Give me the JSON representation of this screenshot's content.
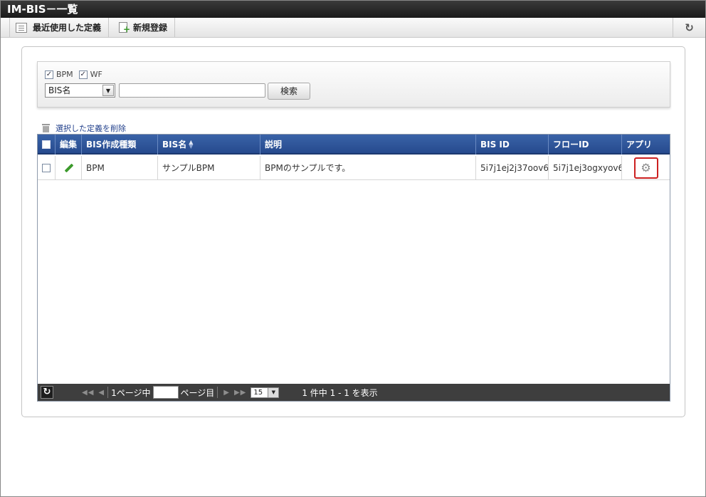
{
  "window": {
    "title": "IM-BIS－一覧"
  },
  "toolbar": {
    "recent_label": "最近使用した定義",
    "new_label": "新規登録",
    "refresh_icon": "refresh-icon"
  },
  "search": {
    "filters": [
      {
        "label": "BPM",
        "checked": true
      },
      {
        "label": "WF",
        "checked": true
      }
    ],
    "field_select_value": "BIS名",
    "keyword_value": "",
    "button_label": "検索"
  },
  "actions": {
    "delete_label": "選択した定義を削除"
  },
  "table": {
    "columns": [
      "",
      "編集",
      "BIS作成種類",
      "BIS名",
      "説明",
      "BIS ID",
      "フローID",
      "アプリ"
    ],
    "rows": [
      {
        "checked": false,
        "edit_icon": "pencil-icon",
        "type": "BPM",
        "name": "サンプルBPM",
        "description": "BPMのサンプルです。",
        "bis_id": "5i7j1ej2j37oov6",
        "flow_id": "5i7j1ej3ogxyov6",
        "app_icon": "gear-icon"
      }
    ]
  },
  "pager": {
    "page_prefix": "1ページ中",
    "page_value": "",
    "page_suffix": "ページ目",
    "page_size": "15",
    "summary": "1 件中 1 - 1 を表示"
  },
  "colors": {
    "header_blue": "#2f559a",
    "pager_bg": "#3e3e3e",
    "highlight_red": "#cc2020",
    "link_blue": "#23418c"
  }
}
